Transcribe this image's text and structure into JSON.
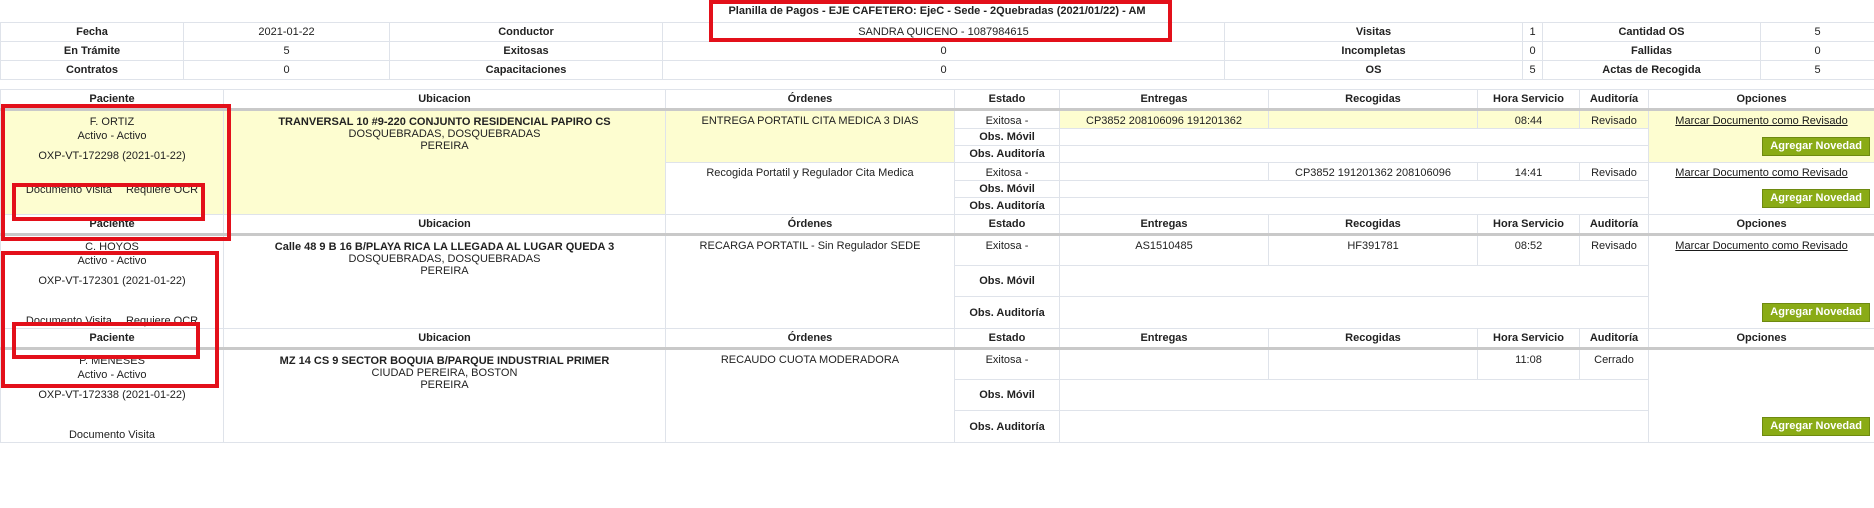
{
  "title": "Planilla de Pagos - EJE CAFETERO: EjeC - Sede - 2Quebradas (2021/01/22) - AM",
  "summary": {
    "rows": [
      [
        {
          "label": "Fecha",
          "value": "2021-01-22"
        },
        {
          "label": "Conductor",
          "value": "SANDRA QUICENO - 1087984615"
        },
        {
          "label": "Visitas",
          "value": "1"
        },
        {
          "label": "Cantidad OS",
          "value": "5"
        }
      ],
      [
        {
          "label": "En Trámite",
          "value": "5"
        },
        {
          "label": "Exitosas",
          "value": "0"
        },
        {
          "label": "Incompletas",
          "value": "0"
        },
        {
          "label": "Fallidas",
          "value": "0"
        }
      ],
      [
        {
          "label": "Contratos",
          "value": "0"
        },
        {
          "label": "Capacitaciones",
          "value": "0"
        },
        {
          "label": "OS",
          "value": "5"
        },
        {
          "label": "Actas de Recogida",
          "value": "5"
        }
      ]
    ]
  },
  "headers": [
    "Paciente",
    "Ubicacion",
    "Órdenes",
    "Estado",
    "Entregas",
    "Recogidas",
    "Hora Servicio",
    "Auditoría",
    "Opciones"
  ],
  "obs_movil": "Obs. Móvil",
  "obs_auditoria": "Obs. Auditoría",
  "mark_label": "Marcar Documento como Revisado",
  "add_label": "Agregar Novedad",
  "doc_visita": "Documento Visita",
  "requiere_ocr": "Requiere OCR",
  "patients": [
    {
      "name": "F. ORTIZ",
      "status": "Activo - Activo",
      "code": "OXP-VT-172298 (2021-01-22)",
      "address": "TRANVERSAL 10 #9-220 CONJUNTO RESIDENCIAL PAPIRO CS",
      "area": "DOSQUEBRADAS, DOSQUEBRADAS",
      "city": "PEREIRA",
      "orders": [
        {
          "orden": "ENTREGA PORTATIL CITA MEDICA 3 DIAS",
          "estado": "Exitosa -",
          "entregas": "CP3852 208106096 191201362",
          "recogidas": "",
          "hora": "08:44",
          "auditoria": "Revisado"
        },
        {
          "orden": "Recogida Portatil y Regulador Cita Medica",
          "estado": "Exitosa -",
          "entregas": "",
          "recogidas": "CP3852 191201362 208106096",
          "hora": "14:41",
          "auditoria": "Revisado"
        }
      ]
    },
    {
      "name": "C. HOYOS",
      "status": "Activo - Activo",
      "code": "OXP-VT-172301 (2021-01-22)",
      "address": "Calle 48 9 B 16 B/PLAYA RICA LA LLEGADA AL LUGAR QUEDA 3",
      "area": "DOSQUEBRADAS, DOSQUEBRADAS",
      "city": "PEREIRA",
      "orders": [
        {
          "orden": "RECARGA PORTATIL - Sin Regulador SEDE",
          "estado": "Exitosa -",
          "entregas": "AS1510485",
          "recogidas": "HF391781",
          "hora": "08:52",
          "auditoria": "Revisado"
        }
      ]
    },
    {
      "name": "P. MENESES",
      "status": "Activo - Activo",
      "code": "OXP-VT-172338 (2021-01-22)",
      "address": "MZ 14 CS 9 SECTOR BOQUIA B/PARQUE INDUSTRIAL PRIMER",
      "area": "CIUDAD PEREIRA, BOSTON",
      "city": "PEREIRA",
      "orders": [
        {
          "orden": "RECAUDO CUOTA MODERADORA",
          "estado": "Exitosa -",
          "entregas": "",
          "recogidas": "",
          "hora": "11:08",
          "auditoria": "Cerrado"
        }
      ]
    }
  ]
}
